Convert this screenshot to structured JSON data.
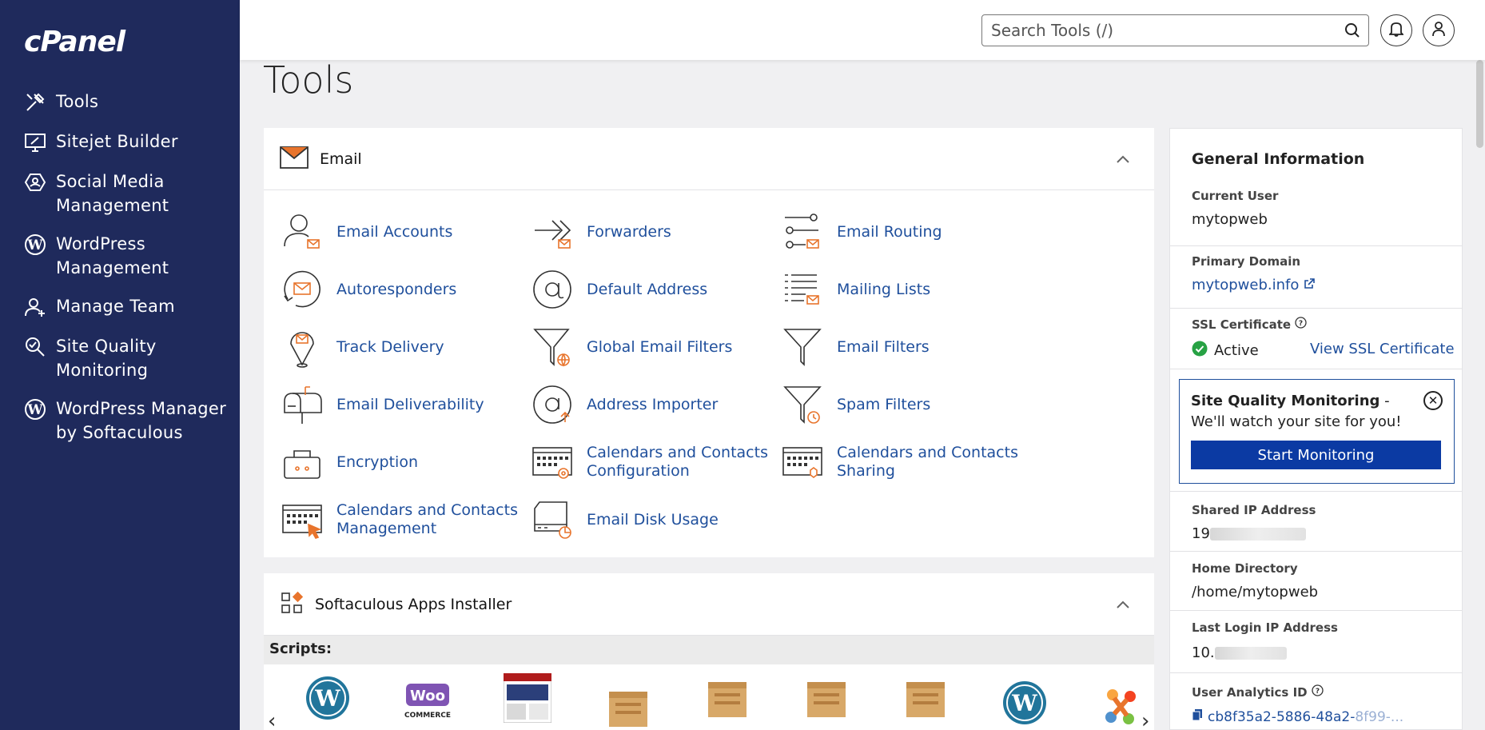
{
  "sidebar": {
    "logo": "cPanel",
    "items": [
      {
        "label": "Tools",
        "icon": "tools-icon"
      },
      {
        "label": "Sitejet Builder",
        "icon": "monitor-pencil-icon"
      },
      {
        "label": "Social Media Management",
        "icon": "social-icon"
      },
      {
        "label": "WordPress Management",
        "icon": "wordpress-icon"
      },
      {
        "label": "Manage Team",
        "icon": "add-user-icon"
      },
      {
        "label": "Site Quality Monitoring",
        "icon": "magnifier-icon"
      },
      {
        "label": "WordPress Manager by Softaculous",
        "icon": "wordpress-icon"
      }
    ]
  },
  "topbar": {
    "search_placeholder": "Search Tools (/)"
  },
  "page_title": "Tools",
  "email": {
    "title": "Email",
    "tools": [
      {
        "label": "Email Accounts"
      },
      {
        "label": "Forwarders"
      },
      {
        "label": "Email Routing"
      },
      {
        "label": "Autoresponders"
      },
      {
        "label": "Default Address"
      },
      {
        "label": "Mailing Lists"
      },
      {
        "label": "Track Delivery"
      },
      {
        "label": "Global Email Filters"
      },
      {
        "label": "Email Filters"
      },
      {
        "label": "Email Deliverability"
      },
      {
        "label": "Address Importer"
      },
      {
        "label": "Spam Filters"
      },
      {
        "label": "Encryption"
      },
      {
        "label": "Calendars and Contacts Configuration"
      },
      {
        "label": "Calendars and Contacts Sharing"
      },
      {
        "label": "Calendars and Contacts Management"
      },
      {
        "label": "Email Disk Usage"
      }
    ]
  },
  "softaculous": {
    "title": "Softaculous Apps Installer",
    "scripts_label": "Scripts:",
    "apps": [
      {
        "name": "WordPress"
      },
      {
        "name": "WooCommerce",
        "logo_text": "Woo"
      },
      {
        "name": "screenshot-app"
      },
      {
        "name": "box-1"
      },
      {
        "name": "box-2"
      },
      {
        "name": "box-3"
      },
      {
        "name": "box-4"
      },
      {
        "name": "WordPress"
      },
      {
        "name": "Joomla"
      }
    ],
    "woo_sub": "COMMERCE",
    "prev": "‹",
    "next": "›"
  },
  "info": {
    "title": "General Information",
    "current_user_label": "Current User",
    "current_user": "mytopweb",
    "primary_domain_label": "Primary Domain",
    "primary_domain": "mytopweb.info",
    "ssl_label": "SSL Certificate",
    "ssl_status": "Active",
    "ssl_link": "View SSL Certificate",
    "popup_bold": "Site Quality Monitoring",
    "popup_text": " - We'll watch your site for you!",
    "popup_button": "Start Monitoring",
    "shared_ip_label": "Shared IP Address",
    "shared_ip": "19",
    "home_dir_label": "Home Directory",
    "home_dir": "/home/mytopweb",
    "last_login_label": "Last Login IP Address",
    "last_login": "10.",
    "analytics_label": "User Analytics ID",
    "analytics_id": "cb8f35a2-5886-48a2-",
    "analytics_faded": "8f99-..."
  },
  "colors": {
    "sidebar_bg": "#1f2a5c",
    "link": "#1f4f9c",
    "accent_orange": "#e8742c",
    "button_blue": "#0b3aa3"
  }
}
